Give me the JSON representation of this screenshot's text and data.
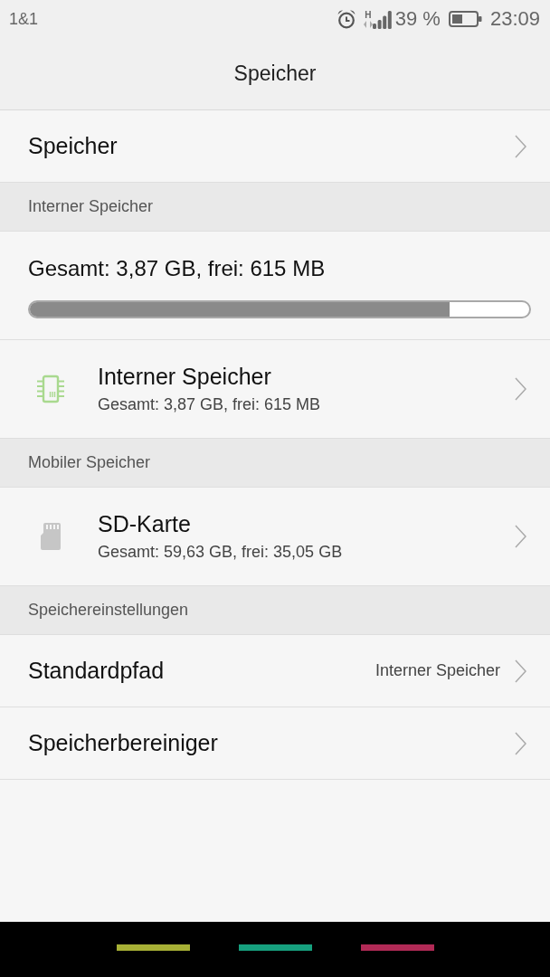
{
  "status_bar": {
    "carrier": "1&1",
    "network_type": "H",
    "battery": "39 %",
    "time": "23:09"
  },
  "title_bar": {
    "title": "Speicher"
  },
  "rows": [
    {
      "kind": "link",
      "title": "Speicher"
    },
    {
      "kind": "header",
      "title": "Interner Speicher"
    },
    {
      "kind": "usage",
      "title": "Gesamt: 3,87 GB, frei: 615 MB",
      "level": 0.84
    },
    {
      "kind": "internal_storage",
      "title": "Interner Speicher",
      "subtitle": "Gesamt: 3,87 GB, frei: 615 MB"
    },
    {
      "kind": "header",
      "title": "Mobiler Speicher"
    },
    {
      "kind": "card_storage",
      "title": "SD-Karte",
      "subtitle": "Gesamt: 59,63 GB, frei: 35,05 GB"
    },
    {
      "kind": "header",
      "title": "Speichereinstellungen"
    },
    {
      "kind": "link",
      "title": "Standardpfad",
      "value": "Interner Speicher"
    },
    {
      "kind": "link",
      "title": "Speicherbereiniger"
    }
  ],
  "nav_bar": {
    "keys": [
      {
        "color": "#a7b035"
      },
      {
        "color": "#16a07e"
      },
      {
        "color": "#b12a56"
      }
    ]
  }
}
